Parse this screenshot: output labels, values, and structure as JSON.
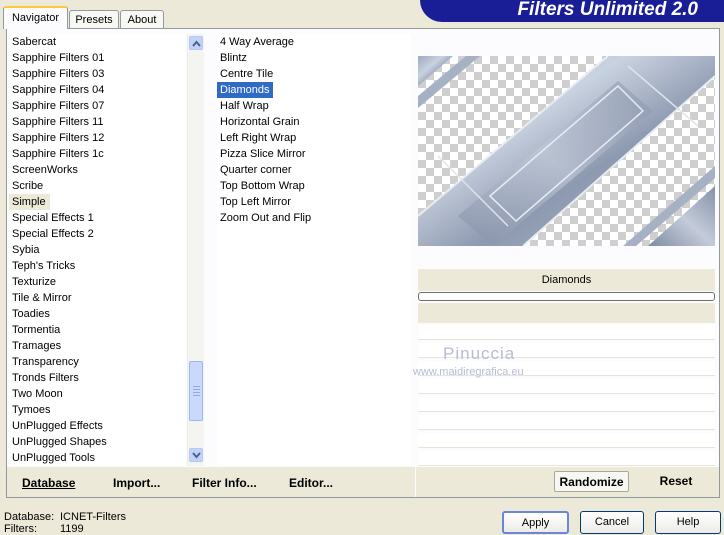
{
  "banner": {
    "title": "Filters Unlimited 2.0"
  },
  "tabs": [
    {
      "label": "Navigator"
    },
    {
      "label": "Presets"
    },
    {
      "label": "About"
    }
  ],
  "categories": {
    "items": [
      "Sabercat",
      "Sapphire Filters 01",
      "Sapphire Filters 03",
      "Sapphire Filters 04",
      "Sapphire Filters 07",
      "Sapphire Filters 11",
      "Sapphire Filters 12",
      "Sapphire Filters 1c",
      "ScreenWorks",
      "Scribe",
      "Simple",
      "Special Effects 1",
      "Special Effects 2",
      "Sybia",
      "Teph's Tricks",
      "Texturize",
      "Tile & Mirror",
      "Toadies",
      "Tormentia",
      "Tramages",
      "Transparency",
      "Tronds Filters",
      "Two Moon",
      "Tymoes",
      "UnPlugged Effects",
      "UnPlugged Shapes",
      "UnPlugged Tools"
    ],
    "selected": "Simple"
  },
  "filters": {
    "items": [
      "4 Way Average",
      "Blintz",
      "Centre Tile",
      "Diamonds",
      "Half Wrap",
      "Horizontal Grain",
      "Left Right Wrap",
      "Pizza Slice Mirror",
      "Quarter corner",
      "Top Bottom Wrap",
      "Top Left Mirror",
      "Zoom Out and Flip"
    ],
    "selected": "Diamonds"
  },
  "toolbar": {
    "database_label": "Database",
    "import_label": "Import...",
    "filter_info_label": "Filter Info...",
    "editor_label": "Editor..."
  },
  "preview": {
    "filter_name": "Diamonds",
    "watermark_name": "Pinuccia",
    "watermark_url": "www.maidiregrafica.eu"
  },
  "actions": {
    "randomize_label": "Randomize",
    "reset_label": "Reset"
  },
  "status": {
    "database_key": "Database:",
    "database_value": "ICNET-Filters",
    "filters_key": "Filters:",
    "filters_value": "1199"
  },
  "footer": {
    "apply_label": "Apply",
    "cancel_label": "Cancel",
    "help_label": "Help"
  },
  "colors": {
    "selection": "#316ac5",
    "banner": "#1a1e96",
    "face": "#ece9d8"
  }
}
